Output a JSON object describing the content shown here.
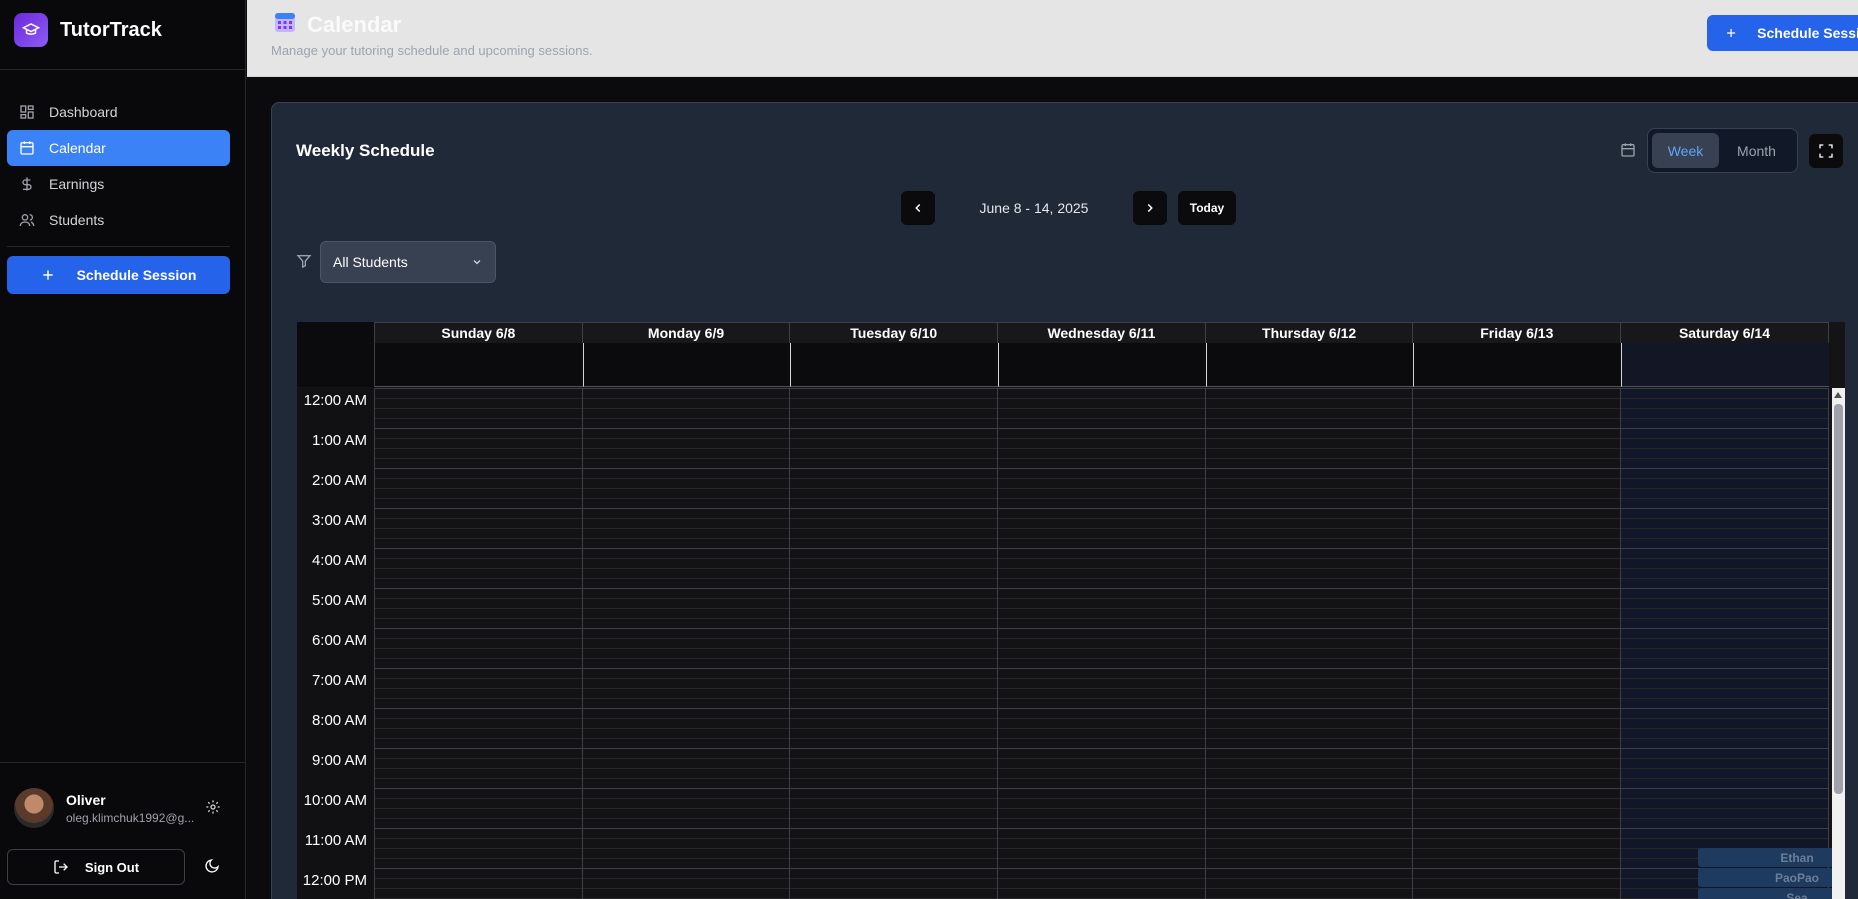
{
  "app": {
    "name": "TutorTrack"
  },
  "sidebar": {
    "items": [
      {
        "label": "Dashboard",
        "icon": "grid-icon",
        "active": false
      },
      {
        "label": "Calendar",
        "icon": "calendar-icon",
        "active": true
      },
      {
        "label": "Earnings",
        "icon": "dollar-icon",
        "active": false
      },
      {
        "label": "Students",
        "icon": "users-icon",
        "active": false
      }
    ],
    "schedule_button": "Schedule Session",
    "user": {
      "name": "Oliver",
      "email": "oleg.klimchuk1992@g..."
    },
    "sign_out": "Sign Out"
  },
  "header": {
    "title": "Calendar",
    "subtitle": "Manage your tutoring schedule and upcoming sessions.",
    "schedule_button": "Schedule Session"
  },
  "calendar": {
    "title": "Weekly Schedule",
    "views": [
      "Week",
      "Month"
    ],
    "active_view": "Week",
    "range": "June 8 - 14, 2025",
    "today_label": "Today",
    "filter": {
      "selected": "All Students"
    },
    "days": [
      "Sunday 6/8",
      "Monday 6/9",
      "Tuesday 6/10",
      "Wednesday 6/11",
      "Thursday 6/12",
      "Friday 6/13",
      "Saturday 6/14"
    ],
    "times": [
      "12:00 AM",
      "1:00 AM",
      "2:00 AM",
      "3:00 AM",
      "4:00 AM",
      "5:00 AM",
      "6:00 AM",
      "7:00 AM",
      "8:00 AM",
      "9:00 AM",
      "10:00 AM",
      "11:00 AM",
      "12:00 PM"
    ],
    "events": [
      {
        "label": "Ethan"
      },
      {
        "label": "PaoPao"
      },
      {
        "label": "Sea"
      }
    ]
  },
  "colors": {
    "accent": "#2563eb",
    "active_nav": "#3b82f6",
    "event": "#1e3a5f"
  }
}
